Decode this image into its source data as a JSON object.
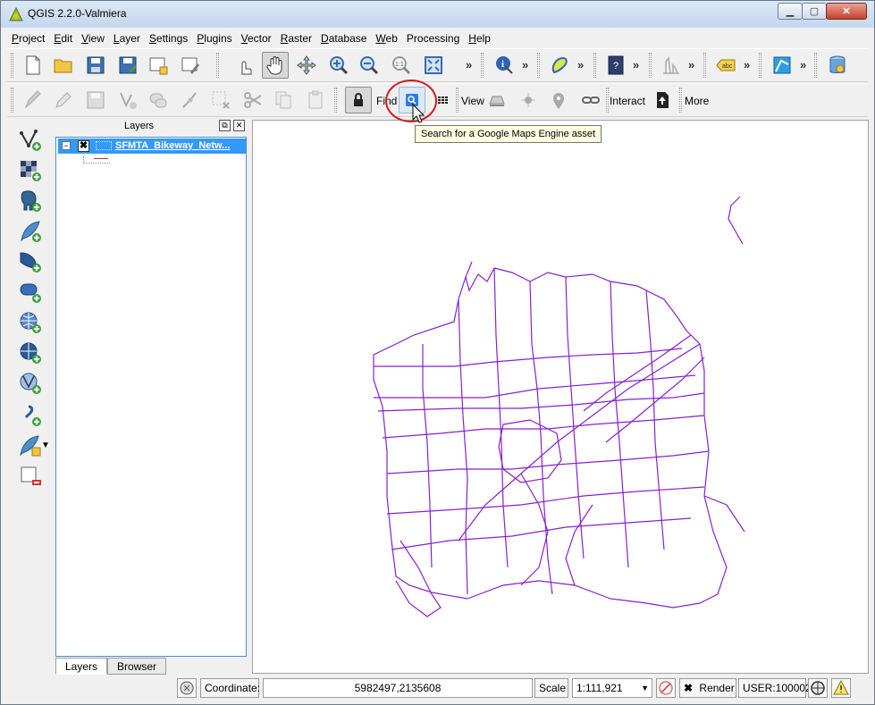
{
  "window": {
    "title": "QGIS 2.2.0-Valmiera",
    "controls": {
      "minimize": "▁",
      "maximize": "▢",
      "close": "✕"
    }
  },
  "menubar": {
    "items": [
      {
        "label": "Project",
        "acc": "P",
        "rest": "roject"
      },
      {
        "label": "Edit",
        "acc": "E",
        "rest": "dit"
      },
      {
        "label": "View",
        "acc": "V",
        "rest": "iew"
      },
      {
        "label": "Layer",
        "acc": "L",
        "rest": "ayer"
      },
      {
        "label": "Settings",
        "acc": "S",
        "rest": "ettings"
      },
      {
        "label": "Plugins",
        "acc": "P",
        "rest": "lugins"
      },
      {
        "label": "Vector",
        "acc": "V",
        "rest": "ector"
      },
      {
        "label": "Raster",
        "acc": "R",
        "rest": "aster"
      },
      {
        "label": "Database",
        "acc": "D",
        "rest": "atabase"
      },
      {
        "label": "Web",
        "acc": "W",
        "rest": "eb"
      },
      {
        "label": "Processing",
        "acc": "",
        "rest": "Processing"
      },
      {
        "label": "Help",
        "acc": "H",
        "rest": "elp"
      }
    ]
  },
  "toolbar2": {
    "find_label": "Find",
    "view_label": "View",
    "interact_label": "Interact",
    "more_label": "More",
    "overflow": "»"
  },
  "tooltip": {
    "text": "Search for a Google Maps Engine asset"
  },
  "layers_panel": {
    "title": "Layers",
    "layer_name": "SFMTA_Bikeway_Netw...",
    "layer_checked": "✖",
    "collapse": "−",
    "tabs": [
      "Layers",
      "Browser"
    ]
  },
  "statusbar": {
    "coordinate_label": "Coordinate:",
    "coordinate_value": "5982497,2135608",
    "scale_label": "Scale",
    "scale_value": "1:111,921",
    "render_label": "Render",
    "render_checked": "✖",
    "crs": "USER:100002"
  },
  "colors": {
    "layer_line": "#8a1fd0",
    "selection": "#3399ff",
    "annotation": "#d11a1a"
  }
}
